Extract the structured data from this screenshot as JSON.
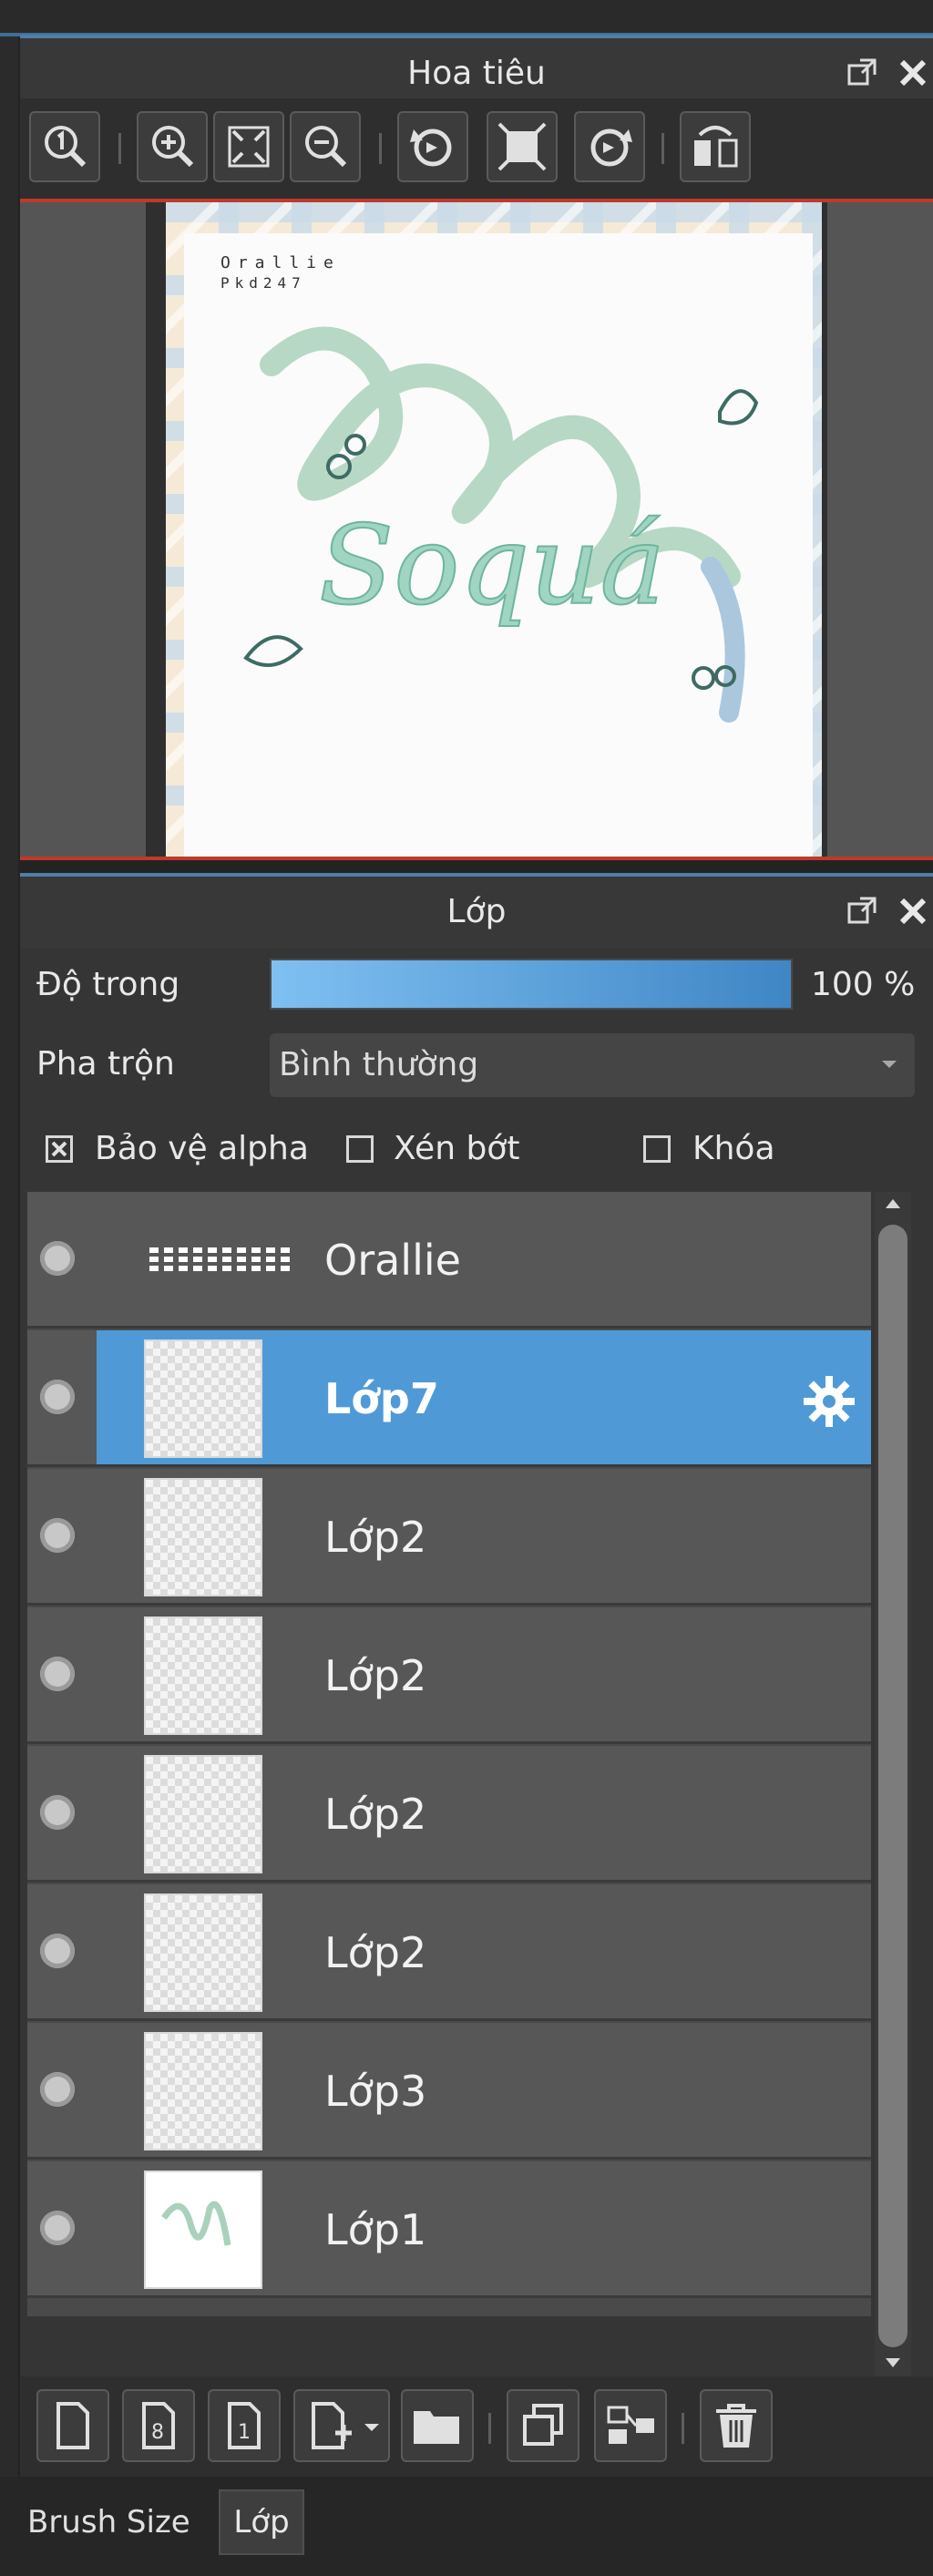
{
  "navigator": {
    "title": "Hoa tiêu",
    "icons": [
      "zoom-100-icon",
      "zoom-in-icon",
      "fit-screen-icon",
      "zoom-out-icon",
      "rotate-left-icon",
      "actual-size-icon",
      "rotate-right-icon",
      "flip-horizontal-icon"
    ],
    "preview": {
      "artist_text": "Orallie",
      "artist_code": "Pkd247",
      "lettering": "Soquá"
    }
  },
  "layers_panel": {
    "title": "Lớp",
    "opacity_label": "Độ trong",
    "opacity_value": "100 %",
    "opacity_fraction": 1.0,
    "blend_label": "Pha trộn",
    "blend_value": "Bình thường",
    "checkboxes": {
      "alpha_protect": {
        "label": "Bảo vệ alpha",
        "checked": true
      },
      "clipping": {
        "label": "Xén bớt",
        "checked": false
      },
      "lock": {
        "label": "Khóa",
        "checked": false
      }
    },
    "layers": [
      {
        "name": "Orallie"
      },
      {
        "name": "Lớp7",
        "selected": true
      },
      {
        "name": "Lớp2"
      },
      {
        "name": "Lớp2"
      },
      {
        "name": "Lớp2"
      },
      {
        "name": "Lớp2"
      },
      {
        "name": "Lớp3"
      },
      {
        "name": "Lớp1"
      }
    ],
    "bottom_icons": [
      "new-layer-icon",
      "new-8bit-layer-icon",
      "new-1bit-layer-icon",
      "add-layer-menu-icon",
      "folder-icon",
      "duplicate-layer-icon",
      "merge-down-icon",
      "delete-layer-icon"
    ]
  },
  "bottom_tabs": [
    {
      "label": "Brush Size"
    },
    {
      "label": "Lớp",
      "active": true
    }
  ],
  "colors": {
    "accent": "#4f9ad6",
    "red_line": "#c0392b"
  }
}
